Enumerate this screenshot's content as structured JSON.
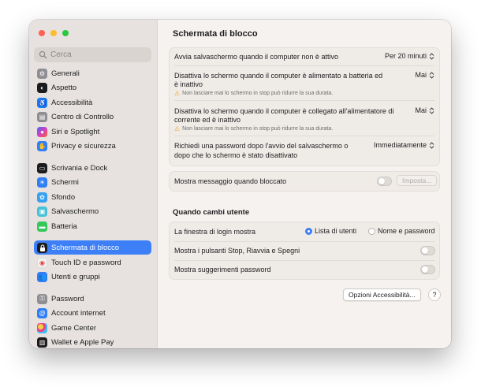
{
  "search": {
    "placeholder": "Cerca"
  },
  "sidebar": {
    "items": [
      {
        "label": "Generali",
        "icon": "gear-icon",
        "color": "#8e8e93"
      },
      {
        "label": "Aspetto",
        "icon": "appearance-icon",
        "color": "#1c1c1e"
      },
      {
        "label": "Accessibilità",
        "icon": "accessibility-icon",
        "color": "#1a7cf5"
      },
      {
        "label": "Centro di Controllo",
        "icon": "control-center-icon",
        "color": "#8e8e93"
      },
      {
        "label": "Siri e Spotlight",
        "icon": "siri-icon",
        "color": "#c643d6"
      },
      {
        "label": "Privacy e sicurezza",
        "icon": "hand-icon",
        "color": "#2f7ff6"
      },
      {
        "label": "Scrivania e Dock",
        "icon": "dock-icon",
        "color": "#1c1c1e"
      },
      {
        "label": "Schermi",
        "icon": "display-icon",
        "color": "#2f7ff6"
      },
      {
        "label": "Sfondo",
        "icon": "wallpaper-icon",
        "color": "#3aa1f0"
      },
      {
        "label": "Salvaschermo",
        "icon": "screensaver-icon",
        "color": "#46c2d8"
      },
      {
        "label": "Batteria",
        "icon": "battery-icon",
        "color": "#34c759"
      },
      {
        "label": "Schermata di blocco",
        "icon": "lock-icon",
        "color": "#1c1c1e"
      },
      {
        "label": "Touch ID e password",
        "icon": "fingerprint-icon",
        "color": "#f2f2f2"
      },
      {
        "label": "Utenti e gruppi",
        "icon": "users-icon",
        "color": "#2f7ff6"
      },
      {
        "label": "Password",
        "icon": "key-icon",
        "color": "#8e8e93"
      },
      {
        "label": "Account internet",
        "icon": "at-icon",
        "color": "#2f7ff6"
      },
      {
        "label": "Game Center",
        "icon": "game-center-icon",
        "color": "#ffffff"
      },
      {
        "label": "Wallet e Apple Pay",
        "icon": "wallet-icon",
        "color": "#1c1c1e"
      }
    ],
    "active_index": 11
  },
  "main": {
    "title": "Schermata di blocco",
    "settings": {
      "screensaver_label": "Avvia salvaschermo quando il computer non è attivo",
      "screensaver_value": "Per 20 minuti",
      "battery_label_1": "Disattiva lo schermo quando il computer è alimentato a batteria ed",
      "battery_label_2": "è inattivo",
      "battery_value": "Mai",
      "battery_warning": "Non lasciare mai lo schermo in stop può ridurre la sua durata.",
      "power_label_1": "Disattiva lo schermo quando il computer è collegato all'alimentatore di",
      "power_label_2": "corrente ed è inattivo",
      "power_value": "Mai",
      "power_warning": "Non lasciare mai lo schermo in stop può ridurre la sua durata.",
      "password_label_1": "Richiedi una password dopo l'avvio del salvaschermo o",
      "password_label_2": "dopo che lo schermo è stato disattivato",
      "password_value": "Immediatamente"
    },
    "message": {
      "label": "Mostra messaggio quando bloccato",
      "button": "Imposta..."
    },
    "switch_section": {
      "heading": "Quando cambi utente",
      "login_label": "La finestra di login mostra",
      "option_users": "Lista di utenti",
      "option_name": "Nome e password",
      "buttons_label": "Mostra i pulsanti Stop, Riavvia e Spegni",
      "hints_label": "Mostra suggerimenti password"
    },
    "footer": {
      "accessibility_button": "Opzioni Accessibilità...",
      "help": "?"
    }
  },
  "colors": {
    "accent": "#3d7ff6",
    "warning": "#f5a623"
  }
}
